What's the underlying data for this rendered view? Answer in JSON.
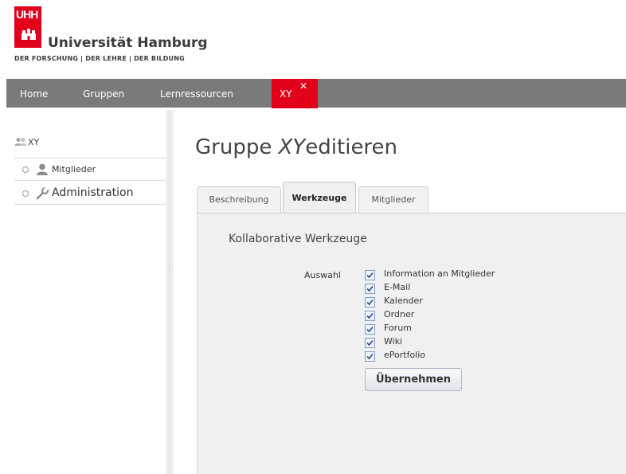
{
  "logo": {
    "short": "UHH",
    "name": "Universität Hamburg",
    "tagline": "DER FORSCHUNG | DER LEHRE | DER BILDUNG",
    "brand_color": "#e2001a"
  },
  "nav": {
    "items": [
      {
        "label": "Home"
      },
      {
        "label": "Gruppen"
      },
      {
        "label": "Lernressourcen"
      }
    ],
    "active": {
      "label": "XY",
      "close_icon": "close-icon"
    }
  },
  "sidebar": {
    "group": {
      "icon": "group-icon",
      "label": "XY"
    },
    "items": [
      {
        "icon": "user-icon",
        "label": "Mitglieder"
      },
      {
        "icon": "wrench-icon",
        "label": "Administration"
      }
    ]
  },
  "main": {
    "title_prefix": "Gruppe ",
    "title_group": "XY",
    "title_suffix": "editieren",
    "tabs": [
      {
        "label": "Beschreibung",
        "active": false
      },
      {
        "label": "Werkzeuge",
        "active": true
      },
      {
        "label": "Mitglieder",
        "active": false
      }
    ],
    "section_title": "Kollaborative Werkzeuge",
    "selection_label": "Auswahl",
    "tools": [
      {
        "label": "Information an Mitglieder",
        "checked": true
      },
      {
        "label": "E-Mail",
        "checked": true
      },
      {
        "label": "Kalender",
        "checked": true
      },
      {
        "label": "Ordner",
        "checked": true
      },
      {
        "label": "Forum",
        "checked": true
      },
      {
        "label": "Wiki",
        "checked": true
      },
      {
        "label": "ePortfolio",
        "checked": true
      }
    ],
    "apply_button": "Übernehmen"
  }
}
